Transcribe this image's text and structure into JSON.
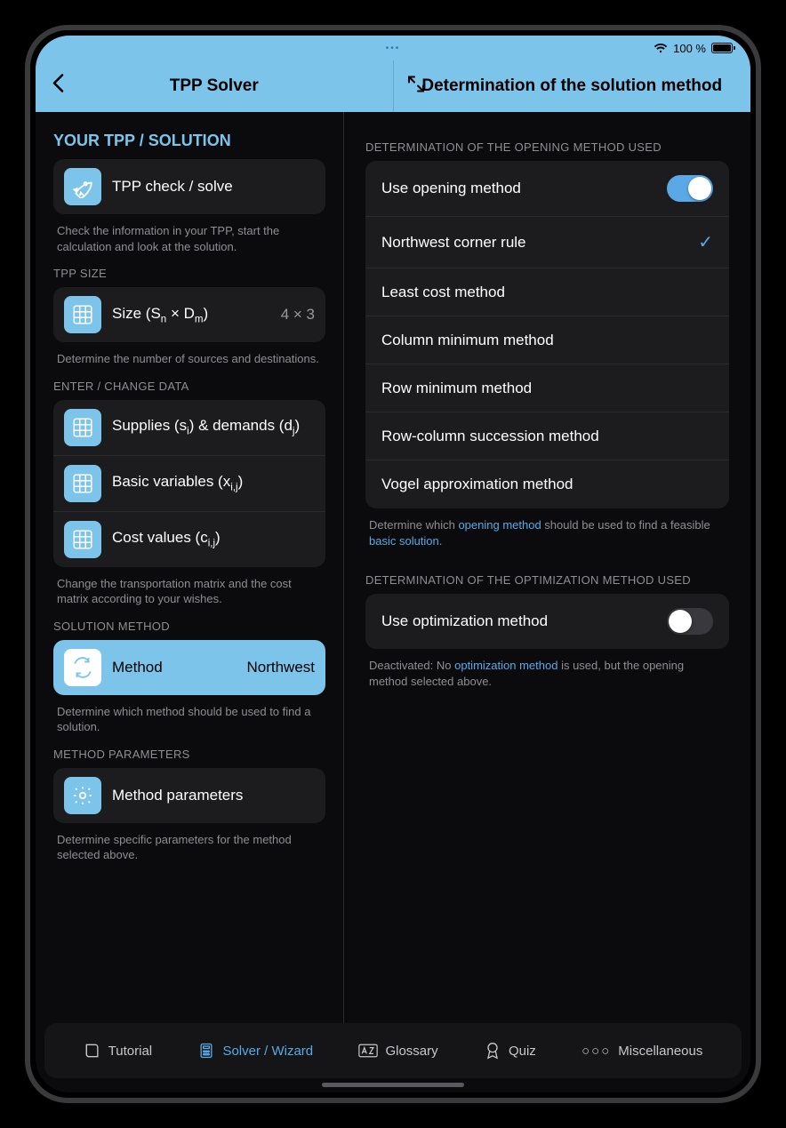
{
  "status": {
    "battery": "100 %"
  },
  "nav": {
    "left_title": "TPP Solver",
    "right_title": "Determination of the solution method"
  },
  "left": {
    "heading1": "YOUR TPP / SOLUTION",
    "solve_label": "TPP check / solve",
    "solve_help": "Check the information in your TPP, start the calculation and look at the solution.",
    "size_heading": "TPP SIZE",
    "size_label": "Size (S",
    "size_sub_n": "n",
    "size_mid": " × D",
    "size_sub_m": "m",
    "size_end": ")",
    "size_value": "4 × 3",
    "size_help": "Determine the number of sources and destinations.",
    "data_heading": "ENTER / CHANGE DATA",
    "supplies_label_a": "Supplies (s",
    "supplies_sub_i": "i",
    "supplies_label_b": ") & demands (d",
    "supplies_sub_j": "j",
    "supplies_label_c": ")",
    "basic_label_a": "Basic variables (x",
    "basic_sub": "i,j",
    "basic_label_b": ")",
    "cost_label_a": "Cost values (c",
    "cost_sub": "i,j",
    "cost_label_b": ")",
    "data_help": "Change the transportation matrix and the cost matrix according to your wishes.",
    "method_heading": "SOLUTION METHOD",
    "method_label": "Method",
    "method_value": "Northwest",
    "method_help": "Determine which method should be used to find a solution.",
    "params_heading": "METHOD PARAMETERS",
    "params_label": "Method parameters",
    "params_help": "Determine specific parameters for the method selected above."
  },
  "right": {
    "open_heading": "DETERMINATION OF THE OPENING METHOD USED",
    "open_toggle_label": "Use opening method",
    "open_toggle_on": true,
    "methods": [
      {
        "label": "Northwest corner rule",
        "selected": true
      },
      {
        "label": "Least cost method",
        "selected": false
      },
      {
        "label": "Column minimum method",
        "selected": false
      },
      {
        "label": "Row minimum method",
        "selected": false
      },
      {
        "label": "Row-column succession method",
        "selected": false
      },
      {
        "label": "Vogel approximation method",
        "selected": false
      }
    ],
    "open_help_a": "Determine which ",
    "open_help_link1": "opening method",
    "open_help_b": " should be used to find a feasible ",
    "open_help_link2": "basic solution",
    "open_help_c": ".",
    "opt_heading": "DETERMINATION OF THE OPTIMIZATION METHOD USED",
    "opt_toggle_label": "Use optimization method",
    "opt_toggle_on": false,
    "opt_help_a": "Deactivated: No ",
    "opt_help_link": "optimization method",
    "opt_help_b": " is used, but the opening method selected above."
  },
  "tabs": {
    "tutorial": "Tutorial",
    "solver": "Solver / Wizard",
    "glossary": "Glossary",
    "quiz": "Quiz",
    "misc": "Miscellaneous"
  }
}
